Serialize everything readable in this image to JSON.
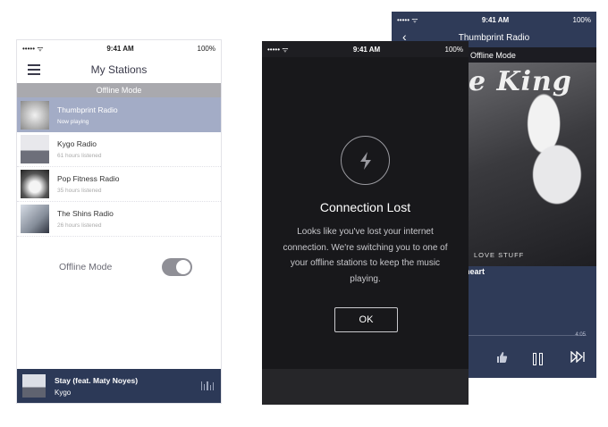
{
  "left_phone": {
    "status": {
      "signal": "••••• ᯤ",
      "time": "9:41 AM",
      "battery": "100%"
    },
    "nav": {
      "title": "My Stations"
    },
    "offline_banner": "Offline Mode",
    "stations": [
      {
        "name": "Thumbprint Radio",
        "sub": "Now playing",
        "active": true
      },
      {
        "name": "Kygo Radio",
        "sub": "61 hours listened",
        "active": false
      },
      {
        "name": "Pop Fitness Radio",
        "sub": "35 hours listened",
        "active": false
      },
      {
        "name": "The Shins Radio",
        "sub": "26 hours listened",
        "active": false
      }
    ],
    "offline_toggle": {
      "label": "Offline Mode",
      "on": true
    },
    "now_playing": {
      "title": "Stay (feat. Maty Noyes)",
      "artist": "Kygo"
    }
  },
  "middle_phone": {
    "status": {
      "signal": "••••• ᯤ",
      "time": "9:41 AM",
      "battery": "100%"
    },
    "icon": "lightning-bolt-icon",
    "dialog_title": "Connection Lost",
    "message": "Looks like you've lost your internet connection. We're switching you to one of your offline stations to keep the music playing.",
    "ok_label": "OK"
  },
  "right_phone": {
    "status": {
      "signal": "••••• ᯤ",
      "time": "9:41 AM",
      "battery": "100%"
    },
    "nav": {
      "title": "Thumbprint Radio"
    },
    "offline_banner": "Offline Mode",
    "album_art_text": "e King",
    "album_subtitle": "LOVE STUFF",
    "song_fragment": "heart",
    "time_remaining": "4:05"
  },
  "colors": {
    "navy": "#2c3957",
    "active_row": "#a3acc6",
    "offline_bar": "#a9a9ae",
    "dialog_bg": "#18181b"
  }
}
